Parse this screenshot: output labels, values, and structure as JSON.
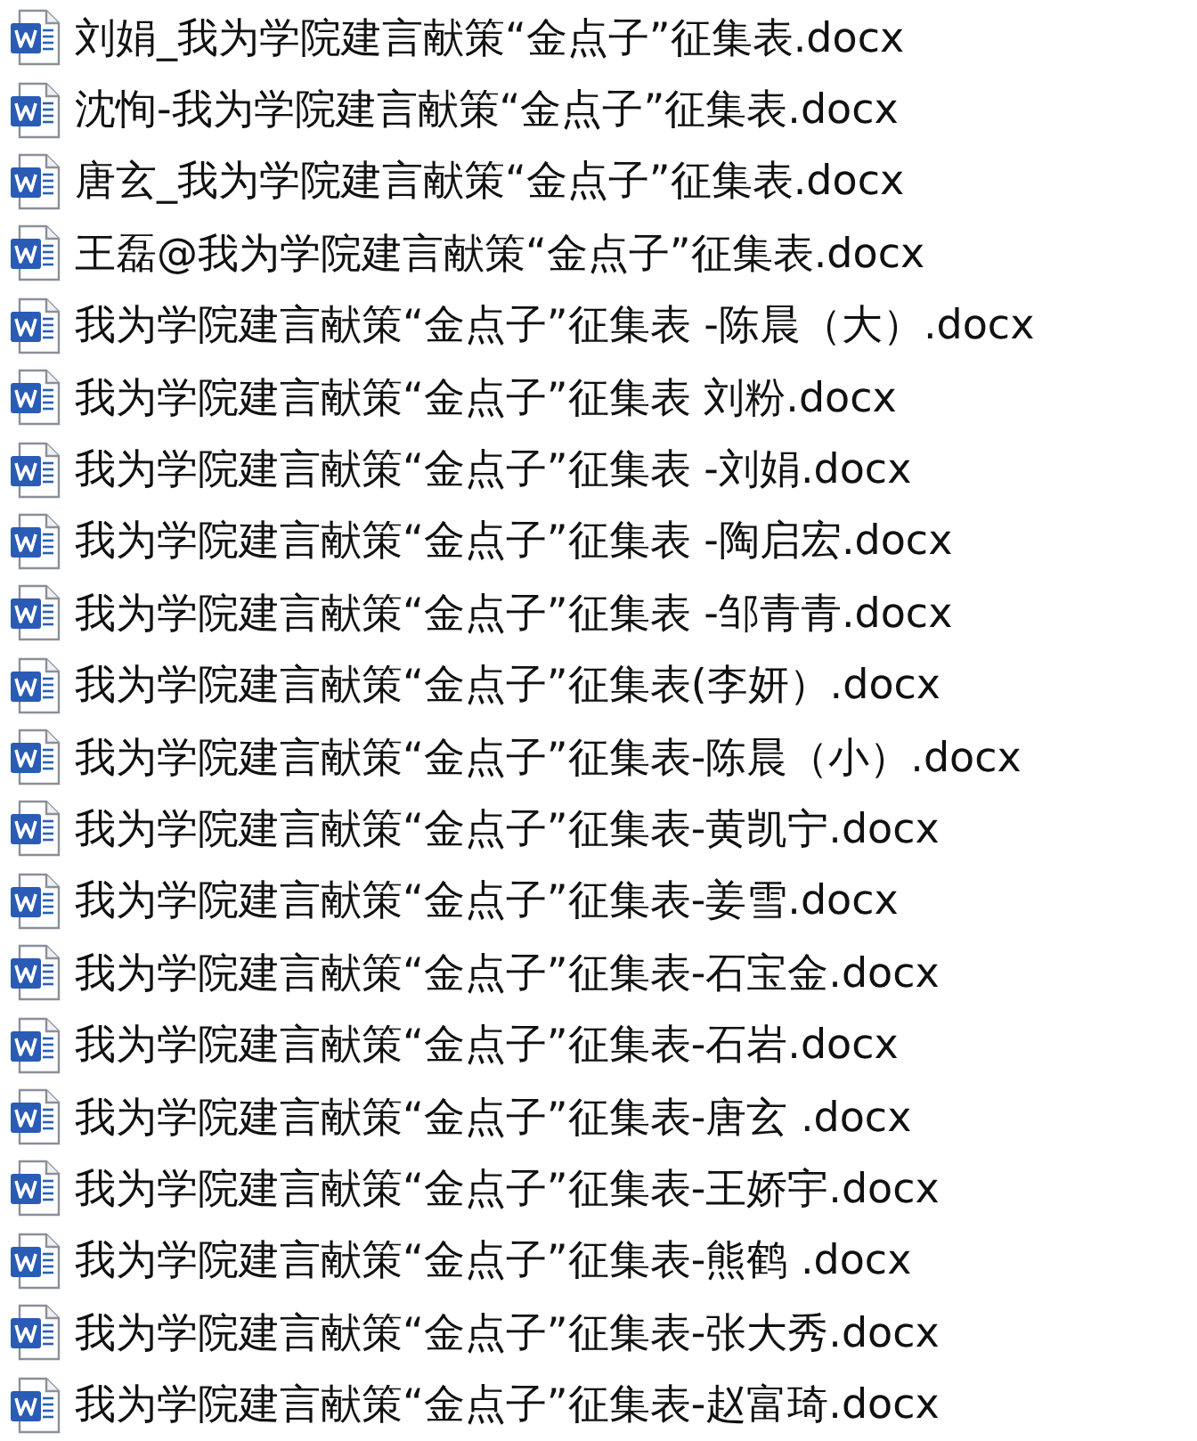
{
  "files": [
    {
      "name": "刘娟_我为学院建言献策“金点子”征集表.docx"
    },
    {
      "name": "沈恂-我为学院建言献策“金点子”征集表.docx"
    },
    {
      "name": "唐玄_我为学院建言献策“金点子”征集表.docx"
    },
    {
      "name": "王磊@我为学院建言献策“金点子”征集表.docx"
    },
    {
      "name": "我为学院建言献策“金点子”征集表 -陈晨（大）.docx"
    },
    {
      "name": "我为学院建言献策“金点子”征集表 刘粉.docx"
    },
    {
      "name": "我为学院建言献策“金点子”征集表 -刘娟.docx"
    },
    {
      "name": "我为学院建言献策“金点子”征集表 -陶启宏.docx"
    },
    {
      "name": "我为学院建言献策“金点子”征集表 -邹青青.docx"
    },
    {
      "name": "我为学院建言献策“金点子”征集表(李妍）.docx"
    },
    {
      "name": "我为学院建言献策“金点子”征集表-陈晨（小）.docx"
    },
    {
      "name": "我为学院建言献策“金点子”征集表-黄凯宁.docx"
    },
    {
      "name": "我为学院建言献策“金点子”征集表-姜雪.docx"
    },
    {
      "name": "我为学院建言献策“金点子”征集表-石宝金.docx"
    },
    {
      "name": "我为学院建言献策“金点子”征集表-石岩.docx"
    },
    {
      "name": "我为学院建言献策“金点子”征集表-唐玄 .docx"
    },
    {
      "name": "我为学院建言献策“金点子”征集表-王娇宇.docx"
    },
    {
      "name": "我为学院建言献策“金点子”征集表-熊鹤 .docx"
    },
    {
      "name": "我为学院建言献策“金点子”征集表-张大秀.docx"
    },
    {
      "name": "我为学院建言献策“金点子”征集表-赵富琦.docx"
    }
  ]
}
